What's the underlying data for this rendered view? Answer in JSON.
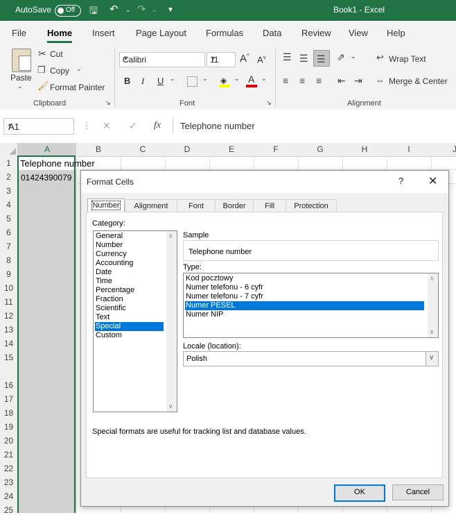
{
  "titlebar": {
    "autosave_label": "AutoSave",
    "autosave_state": "Off",
    "title": "Book1  -  Excel"
  },
  "menu": [
    "File",
    "Home",
    "Insert",
    "Page Layout",
    "Formulas",
    "Data",
    "Review",
    "View",
    "Help"
  ],
  "ribbon": {
    "paste": "Paste",
    "cut": "Cut",
    "copy": "Copy",
    "format_painter": "Format Painter",
    "clipboard_label": "Clipboard",
    "font_name": "Calibri",
    "font_size": "11",
    "font_label": "Font",
    "bold": "B",
    "italic": "I",
    "underline": "U",
    "wrap_text": "Wrap Text",
    "merge_center": "Merge & Center",
    "alignment_label": "Alignment"
  },
  "formula_bar": {
    "name_box": "A1",
    "fx": "fx",
    "content": "Telephone number"
  },
  "columns": [
    "A",
    "B",
    "C",
    "D",
    "E",
    "F",
    "G",
    "H",
    "I",
    "J"
  ],
  "rows": [
    "1",
    "2",
    "3",
    "4",
    "5",
    "6",
    "7",
    "8",
    "9",
    "10",
    "11",
    "12",
    "13",
    "14",
    "15",
    "16",
    "17",
    "18",
    "19",
    "20",
    "21",
    "22",
    "23",
    "24",
    "25"
  ],
  "cells": {
    "A1": "Telephone number",
    "A2": "01424390079"
  },
  "dialog": {
    "title": "Format Cells",
    "help": "?",
    "tabs": [
      "Number",
      "Alignment",
      "Font",
      "Border",
      "Fill",
      "Protection"
    ],
    "category_label": "Category:",
    "categories": [
      "General",
      "Number",
      "Currency",
      "Accounting",
      "Date",
      "Time",
      "Percentage",
      "Fraction",
      "Scientific",
      "Text",
      "Special",
      "Custom"
    ],
    "selected_category": "Special",
    "sample_label": "Sample",
    "sample_value": "Telephone number",
    "type_label": "Type:",
    "types": [
      "Kod pocztowy",
      "Numer telefonu - 6 cyfr",
      "Numer telefonu - 7 cyfr",
      "Numer PESEL",
      "Numer NIP"
    ],
    "selected_type": "Numer PESEL",
    "locale_label": "Locale (location):",
    "locale_value": "Polish",
    "description": "Special formats are useful for tracking list and database values.",
    "ok": "OK",
    "cancel": "Cancel"
  },
  "colors": {
    "excel_green": "#217346",
    "selection_blue": "#0078d7"
  }
}
